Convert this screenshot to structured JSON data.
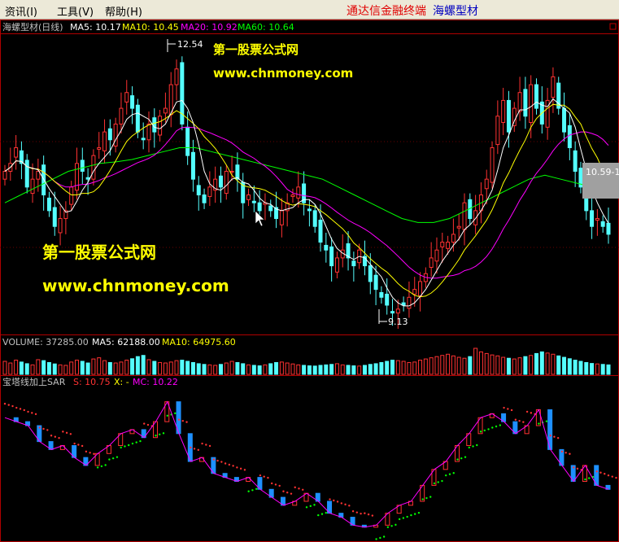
{
  "menu": {
    "items": [
      "资讯(I)",
      "工具(V)",
      "帮助(H)"
    ]
  },
  "title_bar": {
    "app_name": "通达信金融终端",
    "stock_name": "海螺型材"
  },
  "colors": {
    "up": "#ff3232",
    "down": "#54ffff",
    "ma5": "#ffffff",
    "ma10": "#ffff00",
    "ma20": "#ff00ff",
    "ma60": "#00ff00",
    "border": "#b00000",
    "watermark": "#ffff00",
    "sar_up": "#ff3232",
    "sar_down": "#00ff00"
  },
  "price_header": {
    "name": "海螺型材(日线)",
    "ma5": "MA5: 10.17",
    "ma10": "MA10: 10.45",
    "ma20": "MA20: 10.92",
    "ma60": "MA60: 10.64"
  },
  "volume_header": {
    "vol": "VOLUME: 37285.00",
    "ma5": "MA5: 62188.00",
    "ma10": "MA10: 64975.60"
  },
  "sar_header": {
    "name": "宝塔线加上SAR",
    "s": "S: 10.75",
    "x": "X: -",
    "mc": "MC: 10.22"
  },
  "annotations": {
    "high": "12.54",
    "low": "9.13",
    "last": "10.59-1"
  },
  "watermark": {
    "title": "第一股票公式网",
    "url": "www.chnmoney.com"
  },
  "chart_data": [
    {
      "type": "candlestick",
      "title": "海螺型材(日线)",
      "ylim": [
        9.0,
        12.7
      ],
      "highest": 12.54,
      "lowest": 9.13,
      "close": [
        11.0,
        11.1,
        11.3,
        11.1,
        10.8,
        10.9,
        11.0,
        10.7,
        10.5,
        10.3,
        10.4,
        10.5,
        10.8,
        11.1,
        11.0,
        10.9,
        11.2,
        11.3,
        11.5,
        11.4,
        11.6,
        11.8,
        12.0,
        11.8,
        11.5,
        11.4,
        11.6,
        11.5,
        11.7,
        11.8,
        12.1,
        12.3,
        11.6,
        11.2,
        10.9,
        10.7,
        10.6,
        10.8,
        10.9,
        10.8,
        11.0,
        11.0,
        10.9,
        10.6,
        10.7,
        10.6,
        10.5,
        10.6,
        10.5,
        10.4,
        10.5,
        10.6,
        10.7,
        10.8,
        10.6,
        10.5,
        10.3,
        10.1,
        10.0,
        9.8,
        9.9,
        10.0,
        9.9,
        9.8,
        10.0,
        9.8,
        9.6,
        9.5,
        9.4,
        9.3,
        9.2,
        9.25,
        9.3,
        9.4,
        9.5,
        9.6,
        9.7,
        9.9,
        10.0,
        10.1,
        10.1,
        10.2,
        10.3,
        10.6,
        10.4,
        10.5,
        10.7,
        10.9,
        11.3,
        11.7,
        11.9,
        11.5,
        11.8,
        12.0,
        11.7,
        12.1,
        11.8,
        11.6,
        11.9,
        12.2,
        11.8,
        11.5,
        11.3,
        11.0,
        10.8,
        10.5,
        10.3,
        10.4,
        10.3,
        10.2
      ]
    },
    {
      "type": "line",
      "series": [
        {
          "name": "MA60",
          "values": [
            10.6,
            10.7,
            10.8,
            10.9,
            11.0,
            11.05,
            11.1,
            11.12,
            11.15,
            11.2,
            11.25,
            11.3,
            11.3,
            11.25,
            11.2,
            11.15,
            11.1,
            11.05,
            11.0,
            10.95,
            10.9,
            10.8,
            10.7,
            10.6,
            10.5,
            10.4,
            10.35,
            10.35,
            10.4,
            10.5,
            10.6,
            10.7,
            10.8,
            10.9,
            10.95,
            10.9,
            10.85,
            10.8,
            10.75
          ]
        }
      ]
    },
    {
      "type": "bar",
      "title": "VOLUME",
      "values": [
        55,
        48,
        60,
        52,
        45,
        40,
        62,
        58,
        50,
        44,
        40,
        38,
        52,
        60,
        55,
        48,
        65,
        70,
        58,
        50,
        48,
        52,
        60,
        66,
        75,
        80,
        62,
        55,
        50,
        48,
        52,
        58,
        60,
        55,
        50,
        45,
        42,
        40,
        38,
        42,
        48,
        55,
        50,
        45,
        40,
        38,
        36,
        40,
        45,
        50,
        52,
        48,
        44,
        40,
        38,
        36,
        35,
        38,
        40,
        42,
        45,
        40,
        38,
        36,
        35,
        38,
        42,
        45,
        50,
        55,
        60,
        58,
        55,
        50,
        52,
        60,
        65,
        70,
        75,
        80,
        85,
        78,
        72,
        68,
        75,
        110,
        95,
        88,
        82,
        78,
        72,
        68,
        65,
        70,
        75,
        80,
        88,
        95,
        90,
        85,
        78,
        72,
        66,
        60,
        55,
        50,
        46,
        44,
        42,
        40
      ]
    },
    {
      "type": "line",
      "title": "宝塔线加上SAR",
      "series": [
        {
          "name": "MC",
          "values": [
            12.0,
            11.9,
            11.8,
            11.4,
            11.2,
            11.3,
            11.0,
            10.8,
            11.1,
            11.3,
            11.6,
            11.7,
            11.5,
            11.9,
            12.4,
            11.6,
            10.9,
            11.0,
            10.6,
            10.5,
            10.4,
            10.5,
            10.2,
            10.0,
            9.8,
            9.9,
            10.1,
            9.9,
            9.6,
            9.5,
            9.3,
            9.25,
            9.3,
            9.6,
            9.8,
            9.9,
            10.3,
            10.7,
            10.9,
            11.3,
            11.6,
            12.0,
            12.1,
            11.9,
            11.6,
            11.8,
            12.2,
            11.2,
            10.8,
            10.4,
            10.8,
            10.3,
            10.2
          ]
        }
      ]
    }
  ]
}
